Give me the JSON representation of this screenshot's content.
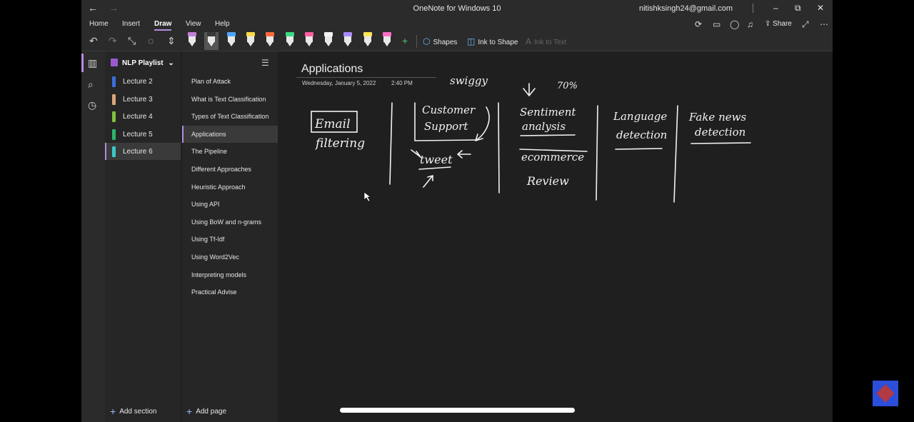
{
  "window": {
    "title": "OneNote for Windows 10",
    "user": "nitishksingh24@gmail.com",
    "nav": {
      "back": "←",
      "forward": "→"
    },
    "controls": {
      "minimize": "–",
      "maximize": "⧉",
      "close": "✕"
    }
  },
  "menu": {
    "tabs": [
      "Home",
      "Insert",
      "Draw",
      "View",
      "Help"
    ],
    "active": "Draw",
    "share_label": "Share"
  },
  "ribbon": {
    "pens": [
      {
        "color": "#c27fd8"
      },
      {
        "color": "#3a3a3a",
        "selected": true
      },
      {
        "color": "#4ca6ff"
      },
      {
        "color": "#ffd94a"
      },
      {
        "color": "#ff6a3d"
      },
      {
        "color": "#3fd97f"
      },
      {
        "color": "#ff5fa2"
      },
      {
        "color": "#f2f2f2"
      },
      {
        "color": "#a98bff"
      },
      {
        "color": "#ffe55a"
      },
      {
        "color": "#ff6fc6"
      }
    ],
    "shapes_label": "Shapes",
    "ink_to_shape_label": "Ink to Shape",
    "ink_to_text_label": "Ink to Text"
  },
  "notebook": {
    "name": "NLP Playlist",
    "sections": [
      {
        "label": "Lecture 2",
        "color": "#3a6fd8"
      },
      {
        "label": "Lecture 3",
        "color": "#d9a77a"
      },
      {
        "label": "Lecture 4",
        "color": "#7fbf3f"
      },
      {
        "label": "Lecture 5",
        "color": "#2fb36a"
      },
      {
        "label": "Lecture 6",
        "color": "#3ec7c7",
        "active": true
      }
    ],
    "add_section_label": "Add section"
  },
  "pages": {
    "items": [
      "Plan of Attack",
      "What is Text Classification",
      "Types of Text Classification",
      "Applications",
      "The Pipeline",
      "Different Approaches",
      "Heuristic Approach",
      "Using API",
      "Using BoW and n-grams",
      "Using Tf-Idf",
      "Using Word2Vec",
      "Interpreting models",
      "Practical Advise"
    ],
    "active_index": 3,
    "add_page_label": "Add page"
  },
  "page": {
    "title": "Applications",
    "date": "Wednesday, January 5, 2022",
    "time": "2:40 PM"
  },
  "ink_text": {
    "email": "Email",
    "filtering": "filtering",
    "customer": "Customer",
    "support": "Support",
    "swiggy": "swiggy",
    "tweet": "tweet",
    "sentiment": "Sentiment",
    "analysis": "analysis",
    "percent": "70%",
    "ecommerce": "ecommerce",
    "review": "Review",
    "language": "Language",
    "detection": "detection",
    "fake_news": "Fake news",
    "fake_detection": "detection"
  }
}
